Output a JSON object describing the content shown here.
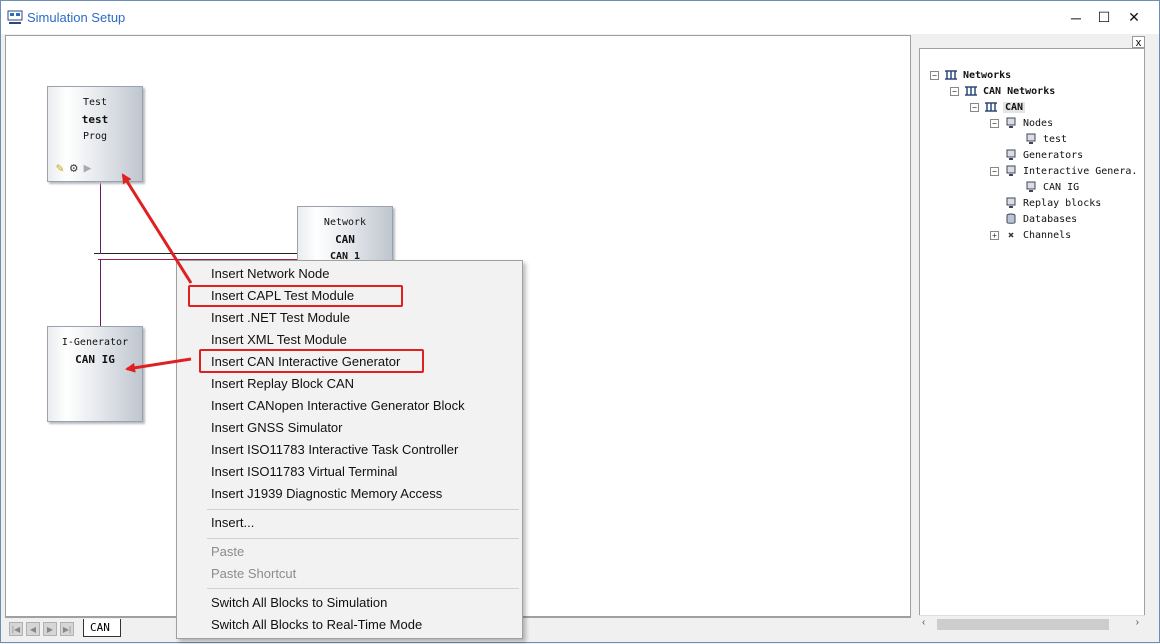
{
  "window": {
    "title": "Simulation Setup",
    "minimize": "─",
    "maximize": "☐",
    "close": "✕"
  },
  "blocks": {
    "test": {
      "line1": "Test",
      "line2": "test",
      "line3": "Prog"
    },
    "network": {
      "line1": "Network",
      "line2": "CAN",
      "line3": "CAN 1"
    },
    "generator": {
      "line1": "I-Generator",
      "line2": "CAN IG"
    }
  },
  "tabs": {
    "active": "CAN"
  },
  "tree": {
    "close": "x",
    "items": [
      {
        "label": "Networks",
        "icon": "network-icon"
      },
      {
        "label": "CAN Networks",
        "icon": "network-icon"
      },
      {
        "label": "CAN",
        "icon": "network-icon"
      },
      {
        "label": "Nodes",
        "icon": "node-icon"
      },
      {
        "label": "test",
        "icon": "node-icon"
      },
      {
        "label": "Generators",
        "icon": "generator-icon"
      },
      {
        "label": "Interactive Genera.",
        "icon": "generator-icon"
      },
      {
        "label": "CAN IG",
        "icon": "generator-icon"
      },
      {
        "label": "Replay blocks",
        "icon": "replay-icon"
      },
      {
        "label": "Databases",
        "icon": "database-icon"
      },
      {
        "label": "Channels",
        "icon": "channel-icon"
      }
    ]
  },
  "menu": {
    "items": [
      "Insert Network Node",
      "Insert CAPL Test Module",
      "Insert .NET Test Module",
      "Insert XML Test Module",
      "Insert CAN Interactive Generator",
      "Insert Replay Block CAN",
      "Insert CANopen Interactive Generator Block",
      "Insert GNSS Simulator",
      "Insert ISO11783 Interactive Task Controller",
      "Insert ISO11783 Virtual Terminal",
      "Insert J1939 Diagnostic Memory Access",
      "Insert...",
      "Paste",
      "Paste Shortcut",
      "Switch All Blocks to Simulation",
      "Switch All Blocks to Real-Time Mode"
    ]
  },
  "colors": {
    "highlight": "#e02020",
    "title": "#2b6cc4",
    "bus_line": "#6a1a6a"
  }
}
